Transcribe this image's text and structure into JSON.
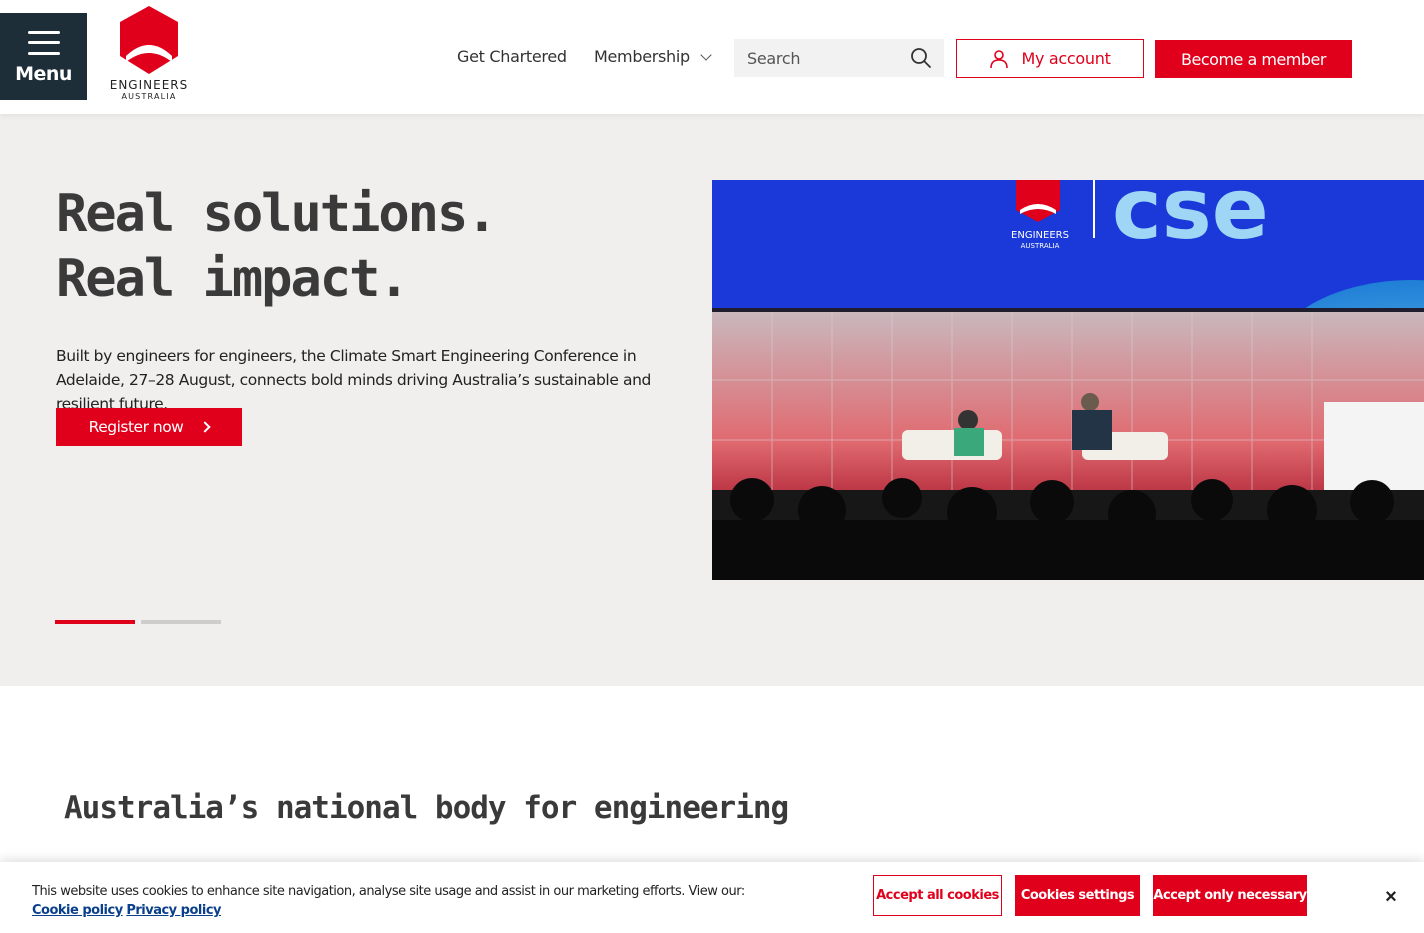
{
  "header": {
    "menu_label": "Menu",
    "logo_line1": "ENGINEERS",
    "logo_line2": "AUSTRALIA",
    "nav": [
      {
        "label": "Get Chartered"
      },
      {
        "label": "Membership"
      }
    ],
    "search_placeholder": "Search",
    "account_label": "My account",
    "member_label": "Become a member"
  },
  "hero": {
    "title": "Real solutions. Real impact.",
    "body": "Built by engineers for engineers, the Climate Smart Engineering Conference in Adelaide, 27–28 August, connects bold minds driving Australia’s sustainable and resilient future.",
    "cta_label": "Register now",
    "image_banner_logo_line1": "ENGINEERS",
    "image_banner_logo_line2": "AUSTRALIA",
    "image_banner_text": "cse",
    "slides_total": 2,
    "slide_active": 1
  },
  "section": {
    "title": "Australia’s national body for engineering"
  },
  "cookie": {
    "text": "This website uses cookies to enhance site navigation, analyse site usage and assist in our marketing efforts. View our:",
    "cookie_policy": "Cookie policy",
    "privacy_policy": "Privacy policy",
    "accept_all": "Accept all cookies",
    "settings": "Cookies settings",
    "necessary": "Accept only necessary",
    "close": "×"
  },
  "colors": {
    "brand_red": "#e0001b",
    "menu_bg": "#1e2e38",
    "hero_bg": "#f1eeee"
  }
}
